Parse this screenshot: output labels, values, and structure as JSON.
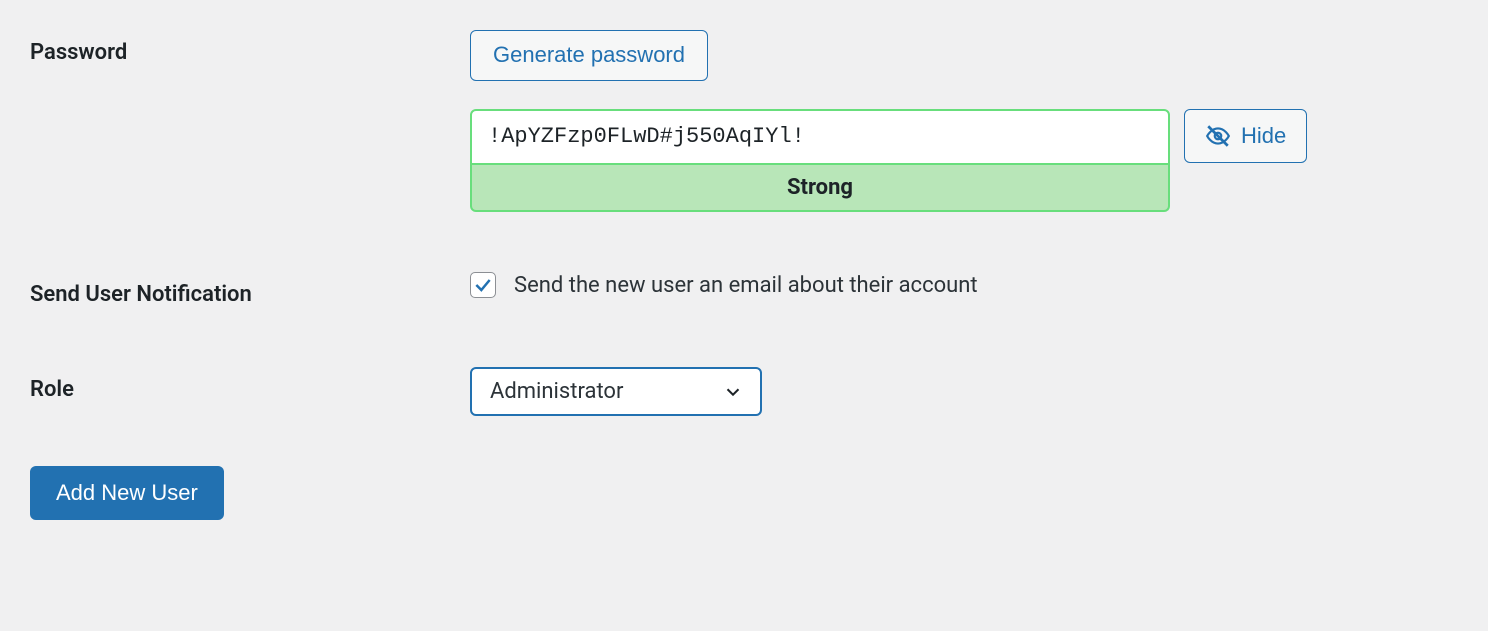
{
  "password": {
    "label": "Password",
    "generate_button": "Generate password",
    "value": "!ApYZFzp0FLwD#j550AqIYl!",
    "strength_label": "Strong",
    "hide_button": "Hide"
  },
  "notification": {
    "label": "Send User Notification",
    "checkbox_label": "Send the new user an email about their account",
    "checked": true
  },
  "role": {
    "label": "Role",
    "selected": "Administrator"
  },
  "submit": {
    "label": "Add New User"
  },
  "colors": {
    "primary": "#2271b1",
    "strength_bg": "#b8e6b8",
    "strength_border": "#68de7c"
  }
}
